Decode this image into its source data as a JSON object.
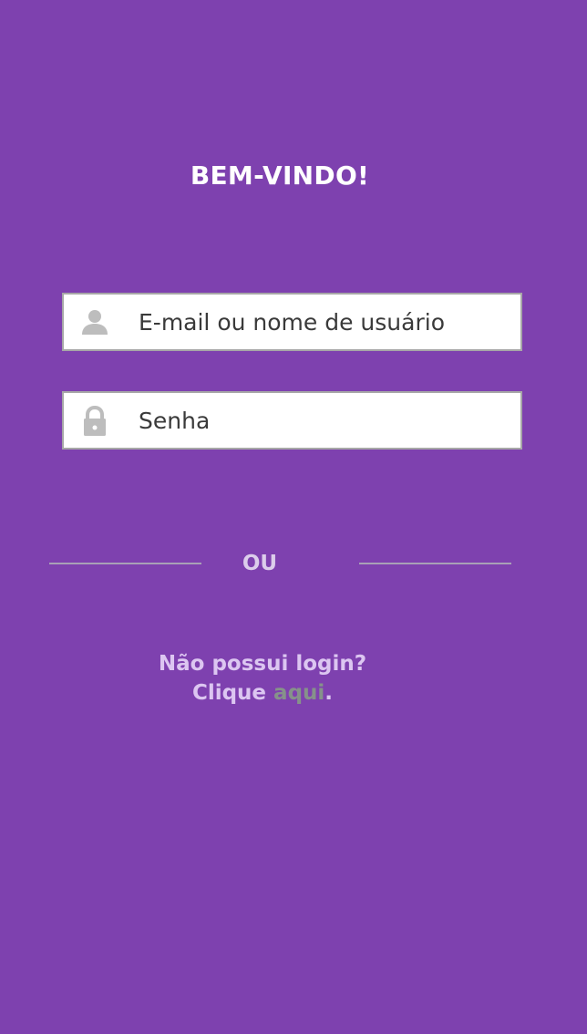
{
  "title": "BEM-VINDO!",
  "email_field": {
    "placeholder": "E-mail ou nome de usuário",
    "value": "",
    "icon": "user-icon"
  },
  "password_field": {
    "placeholder": "Senha",
    "value": "",
    "icon": "lock-icon"
  },
  "divider": {
    "text": "OU"
  },
  "signup": {
    "question": "Não possui login?",
    "prefix": "Clique",
    "link_text": "aqui",
    "suffix": "."
  },
  "colors": {
    "background": "#7E41AF",
    "field_border": "#A7A7A7",
    "icon": "#BDBDBD",
    "link": "#86928A"
  }
}
